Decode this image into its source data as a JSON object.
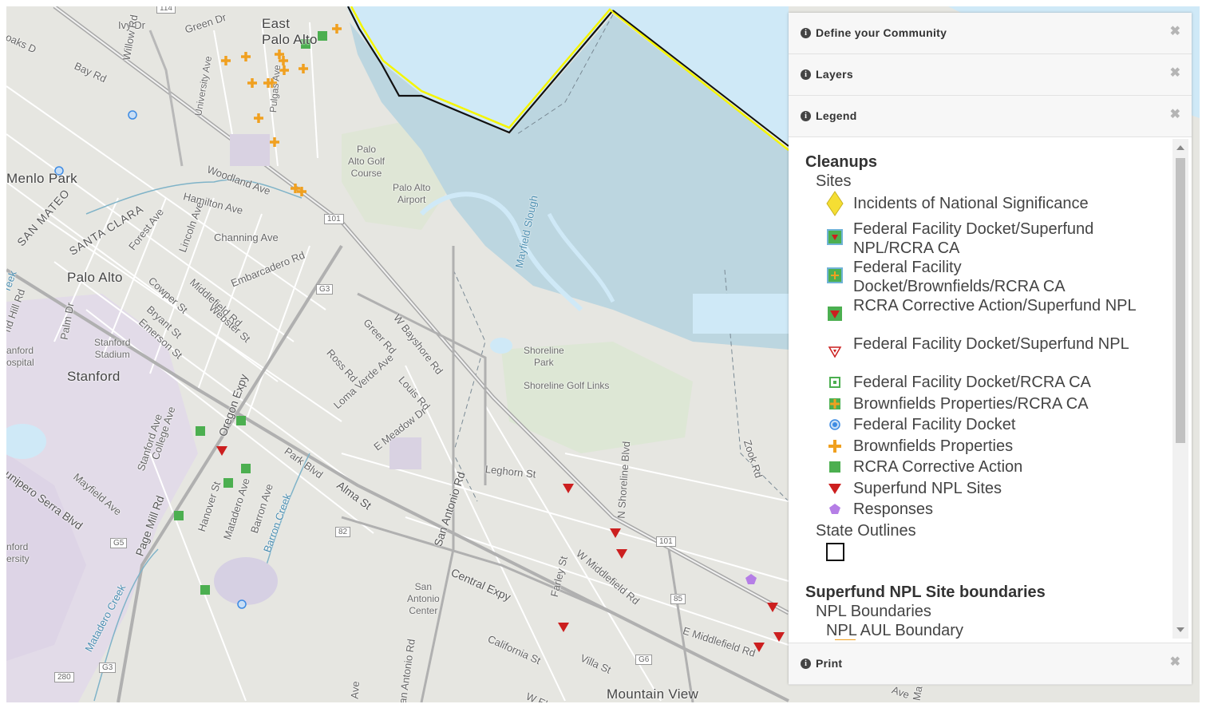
{
  "map": {
    "labels": {
      "east_palo_alto": "East\nPalo Alto",
      "menlo_park": "Menlo Park",
      "palo_alto": "Palo Alto",
      "stanford": "Stanford",
      "mountain_view": "Mountain View",
      "stanford_stadium": "Stanford\nStadium",
      "stanford_hospital": "anford\nospital",
      "stanford_university": "nford\nersity",
      "palo_alto_golf": "Palo\nAlto Golf\nCourse",
      "palo_alto_airport": "Palo Alto\nAirport",
      "shoreline_park": "Shoreline\nPark",
      "shoreline_golf": "Shoreline Golf Links",
      "san_antonio_center": "San\nAntonio\nCenter",
      "san_mateo": "SAN MATEO",
      "santa_clara": "SANTA CLARA",
      "oaks_dr": "oaks D",
      "ivy_dr": "Ivy Dr",
      "green_dr": "Green Dr",
      "bay_rd": "Bay Rd",
      "willow_rd": "Willow Rd",
      "university_ave": "University Ave",
      "pulgas_ave": "Pulgas Ave",
      "woodland_ave": "Woodland Ave",
      "hamilton_ave": "Hamilton Ave",
      "channing_ave": "Channing Ave",
      "forest_ave": "Forest Ave",
      "lincoln_ave": "Lincoln Ave",
      "embarcadero_rd": "Embarcadero Rd",
      "middlefield_rd": "Middlefield Rd",
      "webster_st": "Webster St",
      "cowper_st": "Cowper St",
      "bryant_st": "Bryant St",
      "emerson_st": "Emerson St",
      "palm_dr": "Palm Dr",
      "hill_rd": "nd Hill Rd",
      "creek": "reek",
      "oregon_expy": "Oregon Expy",
      "greer_rd": "Greer Rd",
      "ross_rd": "Ross Rd",
      "loma_verde_ave": "Loma Verde Ave",
      "louis_rd": "Louis Rd",
      "e_meadow_dr": "E Meadow Dr",
      "w_bayshore_rd": "W Bayshore Rd",
      "park_blvd": "Park Blvd",
      "alma_st": "Alma St",
      "stanford_ave": "Stanford Ave",
      "college_ave": "College Ave",
      "mayfield_ave": "Mayfield Ave",
      "junipero_serra": "unipero Serra Blvd",
      "page_mill_rd": "Page Mill Rd",
      "hanover_st": "Hanover St",
      "matadero_ave": "Matadero Ave",
      "barron_ave": "Barron Ave",
      "barron_creek": "Barron Creek",
      "matadero_creek": "Matadero Creek",
      "san_antonio_rd": "San Antonio Rd",
      "san_antonio_rd2": "an Antonio Rd",
      "central_expy": "Central Expy",
      "leghorn_st": "Leghorn St",
      "n_shoreline_blvd": "N Shoreline Blvd",
      "farley_st": "Farley St",
      "w_middlefield_rd": "W Middlefield Rd",
      "e_middlefield_rd": "E Middlefield Rd",
      "california_st": "California St",
      "villa_st": "Villa St",
      "zook_rd": "Zook Rd",
      "mayfield_slough": "Mayfield Slough",
      "ave_bottom": "Ave",
      "ave_right": "Ave",
      "w_el": "W El",
      "ma": "Ma"
    },
    "shields": {
      "us101_a": "101",
      "us101_b": "101",
      "g3_a": "G3",
      "g3_b": "G3",
      "g5": "G5",
      "g6": "G6",
      "r82": "82",
      "r85": "85",
      "i280": "280",
      "r114": "114"
    }
  },
  "panel": {
    "define_community": "Define your Community",
    "layers": "Layers",
    "legend": "Legend",
    "print": "Print",
    "close_glyph": "✖",
    "info_glyph": "i"
  },
  "legend": {
    "cleanups_heading": "Cleanups",
    "sites_label": "Sites",
    "items": [
      {
        "label": "Incidents of National Significance",
        "symbol": "diamond-icon"
      },
      {
        "label": "Federal Facility Docket/Superfund NPL/RCRA CA",
        "symbol": "green-square-red-triangle-icon"
      },
      {
        "label": "Federal Facility Docket/Brownfields/RCRA CA",
        "symbol": "green-square-orange-cross-icon"
      },
      {
        "label": "RCRA Corrective Action/Superfund NPL",
        "symbol": "green-red-triangle-icon"
      },
      {
        "label": "Federal Facility Docket/Superfund NPL",
        "symbol": "hollow-red-triangle-icon"
      },
      {
        "label": "Federal Facility Docket/RCRA CA",
        "symbol": "hollow-green-square-icon"
      },
      {
        "label": "Brownfields Properties/RCRA CA",
        "symbol": "green-square-cross-icon"
      },
      {
        "label": "Federal Facility Docket",
        "symbol": "blue-circle-icon"
      },
      {
        "label": "Brownfields Properties",
        "symbol": "orange-cross-icon"
      },
      {
        "label": "RCRA Corrective Action",
        "symbol": "green-square-icon"
      },
      {
        "label": "Superfund NPL Sites",
        "symbol": "red-triangle-icon"
      },
      {
        "label": "Responses",
        "symbol": "purple-pentagon-icon"
      }
    ],
    "state_outlines_label": "State Outlines",
    "npl_heading": "Superfund NPL Site boundaries",
    "npl_boundaries_label": "NPL Boundaries",
    "npl_aul_label": "NPL AUL Boundary"
  },
  "colors": {
    "bay_water": "#cfe9f7",
    "bay_outline": "#111111",
    "bay_yellow": "#f5f500",
    "marsh": "#bcd6e0",
    "land": "#e6e6e1",
    "road": "#ffffff",
    "highway": "#9a9a9a",
    "green_square": "#4caf50",
    "red_triangle": "#cc1f1f",
    "orange_cross": "#f0a020",
    "blue_circle": "#3d8be3",
    "yellow_diamond": "#f5de33",
    "purple_pentagon": "#b57ee6"
  }
}
